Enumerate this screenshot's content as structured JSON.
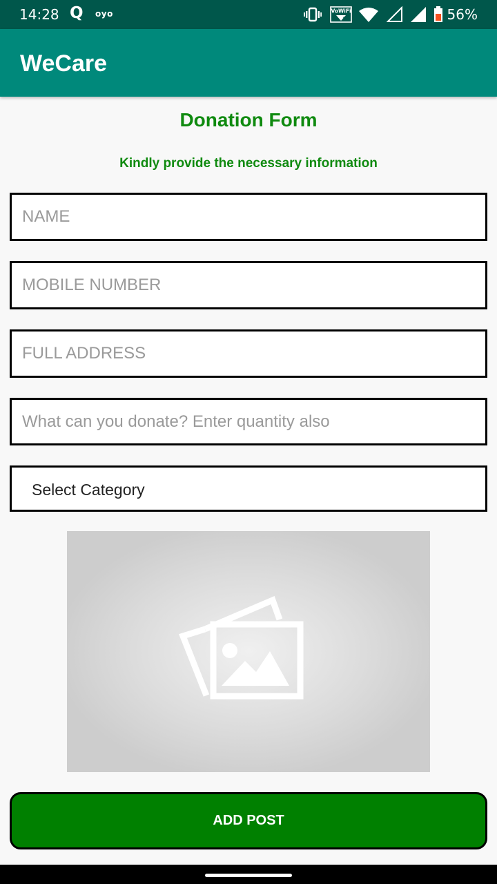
{
  "status_bar": {
    "time": "14:28",
    "q_label": "Q",
    "oyo_label": "OYO",
    "vowifi_label": "VoWiFi",
    "vowifi_sub": "2",
    "battery_percent": "56%",
    "icons": [
      "vibrate-icon",
      "vowifi-icon",
      "wifi-icon",
      "signal-empty-icon",
      "signal-full-icon",
      "battery-icon"
    ]
  },
  "app_bar": {
    "title": "WeCare",
    "color": "#00897b"
  },
  "form": {
    "title": "Donation Form",
    "subtitle": "Kindly provide the necessary information",
    "name_placeholder": "NAME",
    "mobile_placeholder": "MOBILE NUMBER",
    "address_placeholder": "FULL ADDRESS",
    "donation_placeholder": "What can you donate? Enter quantity also",
    "category_selected": "Select Category",
    "image_placeholder_icon": "image-placeholder-icon",
    "submit_label": "ADD POST",
    "accent_color": "#008000"
  }
}
